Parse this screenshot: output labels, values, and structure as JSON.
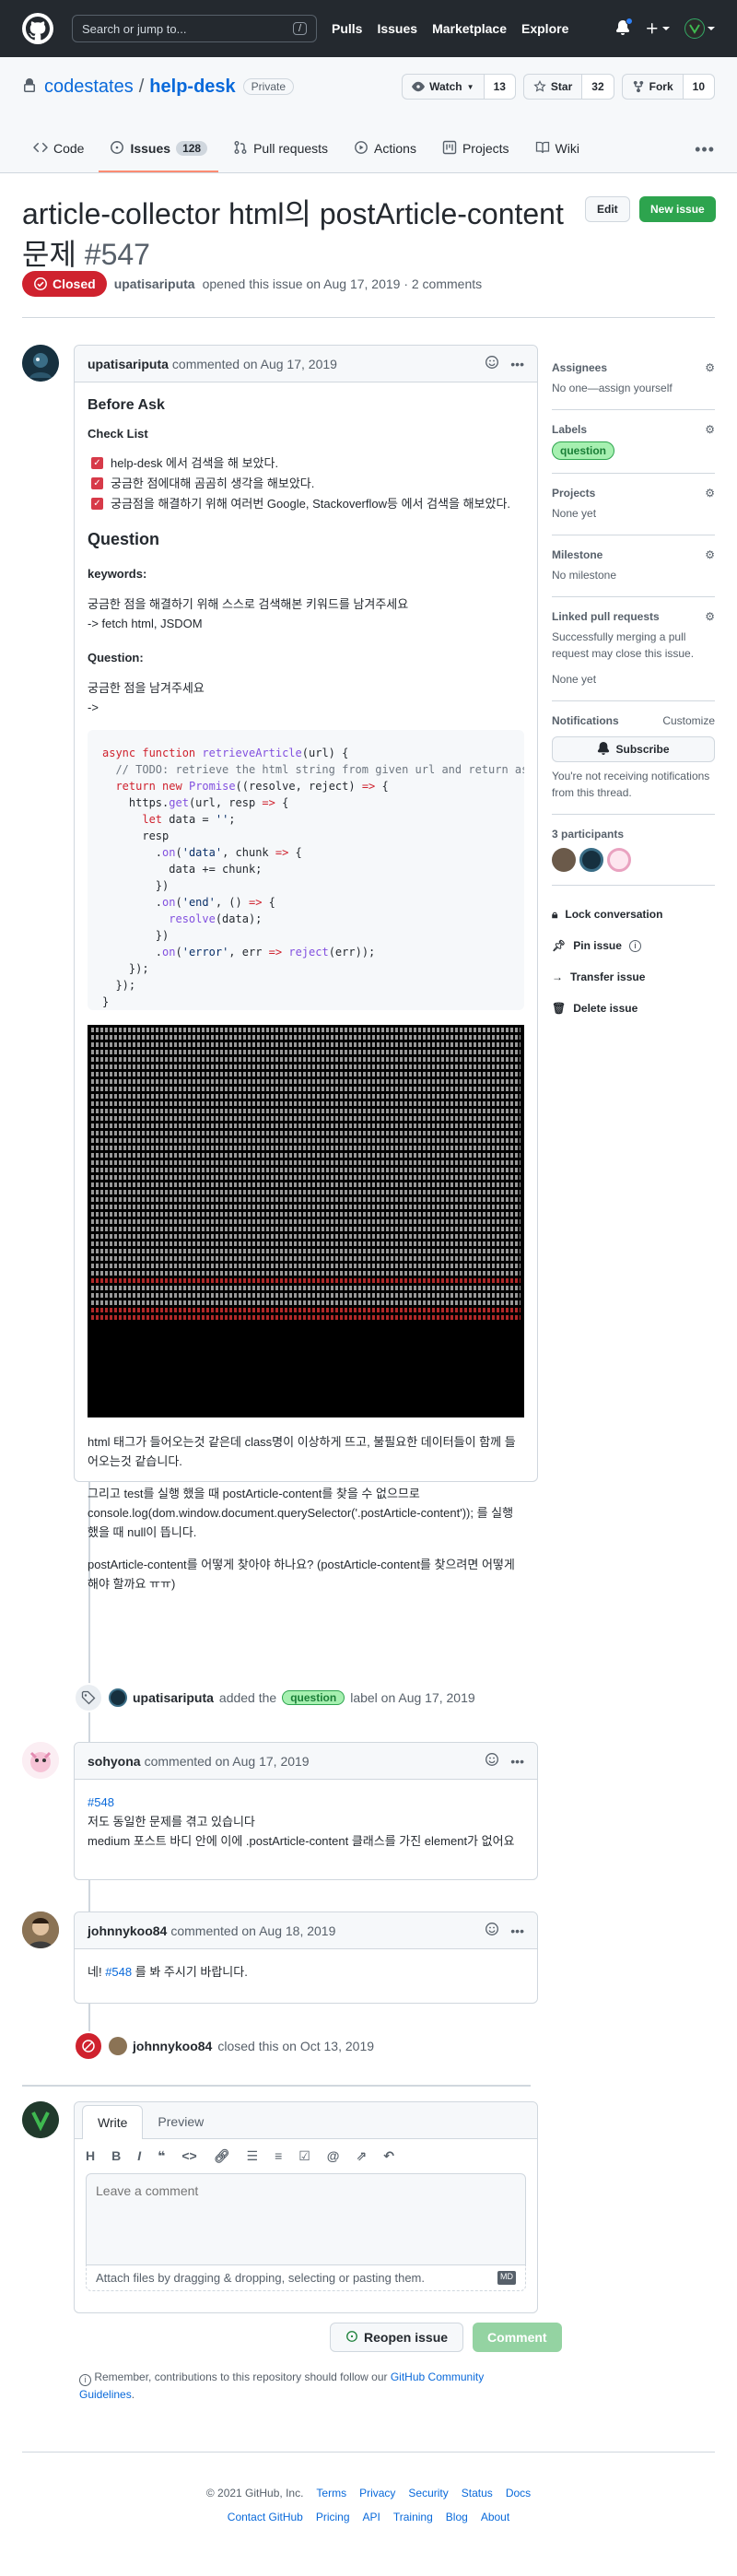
{
  "header": {
    "search_placeholder": "Search or jump to...",
    "search_key": "/",
    "nav": [
      "Pulls",
      "Issues",
      "Marketplace",
      "Explore"
    ]
  },
  "repo": {
    "owner": "codestates",
    "separator": "/",
    "name": "help-desk",
    "visibility": "Private",
    "watch_label": "Watch",
    "watch_count": "13",
    "star_label": "Star",
    "star_count": "32",
    "fork_label": "Fork",
    "fork_count": "10",
    "tabs": [
      {
        "label": "Code"
      },
      {
        "label": "Issues",
        "count": "128"
      },
      {
        "label": "Pull requests"
      },
      {
        "label": "Actions"
      },
      {
        "label": "Projects"
      },
      {
        "label": "Wiki"
      }
    ]
  },
  "issue": {
    "title": "article-collector html의 postArticle-content 문제",
    "number": "#547",
    "edit_label": "Edit",
    "new_issue_label": "New issue",
    "state": "Closed",
    "author": "upatisariputa",
    "opened_text": "opened this issue on Aug 17, 2019 · 2 comments"
  },
  "comments": [
    {
      "author": "upatisariputa",
      "date_text": "commented on Aug 17, 2019",
      "h_before": "Before Ask",
      "h_checklist": "Check List",
      "checks": [
        "help-desk 에서 검색을 해 보았다.",
        "궁금한 점에대해 곰곰히 생각을 해보았다.",
        "궁금점을 해결하기 위해 여러번 Google, Stackoverflow등 에서 검색을 해보았다."
      ],
      "h_question": "Question",
      "keywords_label": "keywords:",
      "keywords_p1": "궁금한 점을 해결하기 위해 스스로 검색해본 키워드를 남겨주세요",
      "keywords_p2": "-> fetch html, JSDOM",
      "question_label": "Question:",
      "question_p1": "궁금한 점을 남겨주세요",
      "question_p2": "->",
      "para1": "html 태그가 들어오는것 같은데 class명이 이상하게 뜨고, 불필요한 데이터들이 함께 들어오는것 같습니다.",
      "para2": "그리고 test를 실행 했을 때 postArticle-content를 찾을 수 없으므로 console.log(dom.window.document.querySelector('.postArticle-content')); 를 실행 했을 때 null이 뜹니다.",
      "para3": "postArticle-content를 어떻게 찾아야 하나요? (postArticle-content를 찾으려면 어떻게 해야 할까요 ㅠㅠ)"
    },
    {
      "author": "sohyona",
      "date_text": "commented on Aug 17, 2019",
      "link": "#548",
      "line1": "저도 동일한 문제를 겪고 있습니다",
      "line2": "medium 포스트 바디 안에 이에 .postArticle-content 클래스를 가진 element가 없어요"
    },
    {
      "author": "johnnykoo84",
      "date_text": "commented on Aug 18, 2019",
      "pre": "네!",
      "link": "#548",
      "post": "를 봐 주시기 바랍니다."
    }
  ],
  "events": {
    "label_actor": "upatisariputa",
    "label_pre": "added the",
    "label_name": "question",
    "label_post": "label on Aug 17, 2019",
    "closed_actor": "johnnykoo84",
    "closed_text": "closed this on Oct 13, 2019"
  },
  "sidebar": {
    "assignees_h": "Assignees",
    "assignees_v": "No one—assign yourself",
    "labels_h": "Labels",
    "label": "question",
    "projects_h": "Projects",
    "projects_v": "None yet",
    "milestone_h": "Milestone",
    "milestone_v": "No milestone",
    "linked_h": "Linked pull requests",
    "linked_v1": "Successfully merging a pull request may close this issue.",
    "linked_v2": "None yet",
    "notif_h": "Notifications",
    "customize": "Customize",
    "subscribe": "Subscribe",
    "notif_v": "You're not receiving notifications from this thread.",
    "participants": "3 participants",
    "lock": "Lock conversation",
    "pin": "Pin issue",
    "transfer": "Transfer issue",
    "delete": "Delete issue"
  },
  "composer": {
    "tab_write": "Write",
    "tab_preview": "Preview",
    "toolbar": [
      "H",
      "B",
      "I"
    ],
    "placeholder": "Leave a comment",
    "attach": "Attach files by dragging & dropping, selecting or pasting them.",
    "md_badge": "MD",
    "reopen": "Reopen issue",
    "comment": "Comment",
    "remember": "Remember, contributions to this repository should follow our",
    "guidelines": "GitHub Community Guidelines",
    "period": "."
  },
  "footer": {
    "copy": "© 2021 GitHub, Inc.",
    "row1": [
      "Terms",
      "Privacy",
      "Security",
      "Status",
      "Docs"
    ],
    "row2": [
      "Contact GitHub",
      "Pricing",
      "API",
      "Training",
      "Blog",
      "About"
    ]
  },
  "colors": {
    "closed": "#cf222e",
    "accent": "#0969da",
    "primary": "#2da44e",
    "label_bg": "#a6f0b0"
  }
}
